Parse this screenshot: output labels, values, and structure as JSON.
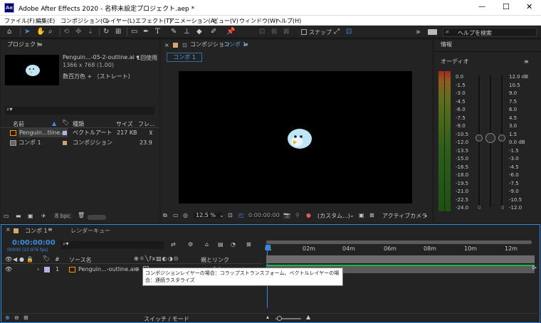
{
  "window": {
    "app_badge": "Ae",
    "title": "Adobe After Effects 2020 - 名称未設定プロジェクト.aep *",
    "minimize": "—",
    "maximize": "☐",
    "close": "✕"
  },
  "menu": [
    "ファイル(F)",
    "編集(E)",
    "コンポジション(C)",
    "レイヤー(L)",
    "エフェクト(T)",
    "アニメーション(A)",
    "ビュー(V)",
    "ウィンドウ(W)",
    "ヘルプ(H)"
  ],
  "toolbar": {
    "snap_label": "スナップ",
    "help_placeholder": "ヘルプを検索",
    "expand": "»"
  },
  "project": {
    "title": "プロジェクト",
    "selected_name": "Penguin...-05-2-outline.ai ▾",
    "used": "1回使用",
    "dims": "1366 x 768 (1.00)",
    "color_info": "数百万色 + （ストレート）",
    "bpc": "8 bpc",
    "columns": [
      "名前",
      "種類",
      "サイズ",
      "フレ..."
    ],
    "items": [
      {
        "name": "Penguin...tline.ai",
        "type": "ベクトルアート",
        "size": "217 KB",
        "fr": ""
      },
      {
        "name": "コンポ 1",
        "type": "コンポジション",
        "size": "",
        "fr": "23.9"
      }
    ]
  },
  "comp": {
    "panel_prefix": "コンポジション",
    "comp_name": "コンポ 1",
    "tab": "コンポ 1",
    "zoom": "12.5 %",
    "timecode": "0:00:00:00",
    "resolution": "(カスタム...)",
    "camera": "アクティブカメラ"
  },
  "info": {
    "title": "情報",
    "audio_title": "オーディオ",
    "left_scale": [
      "0.0",
      "-1.5",
      "-3.0",
      "-4.5",
      "-6.0",
      "-7.5",
      "-9.0",
      "-10.5",
      "-12.0",
      "-13.5",
      "-15.0",
      "-16.5",
      "-18.0",
      "-19.5",
      "-21.0",
      "-22.5",
      "-24.0"
    ],
    "right_scale": [
      "12.0 dB",
      "10.5",
      "9.0",
      "7.5",
      "6.0",
      "4.5",
      "3.0",
      "1.5",
      "0.0 dB",
      "-1.5",
      "-3.0",
      "-4.5",
      "-6.0",
      "-7.5",
      "-9.0",
      "-10.5",
      "-12.0"
    ],
    "knob_val_left": "0",
    "knob_val_right": "0"
  },
  "timeline": {
    "tab": "コンポ 1",
    "render_tab": "レンダーキュー",
    "timecode": "0:00:00:00",
    "frame_info": "00000 (23.976 fps)",
    "columns": {
      "num": "#",
      "source": "ソース名",
      "parent": "親とリンク"
    },
    "layer": {
      "num": "1",
      "name": "Penguin...-outline.ai",
      "parent": "なし"
    },
    "ruler": [
      "0s",
      "02m",
      "04m",
      "06m",
      "08m",
      "10m",
      "12m"
    ],
    "mode_label": "スイッチ / モード",
    "tooltip": "コンポジションレイヤーの場合：コラップストランスフォーム、ベクトルレイヤーの場合：連続ラスタライズ"
  },
  "colors": {
    "accent": "#2d8ceb",
    "timecode": "#3a8bdb",
    "workarea": "#5a5a5a",
    "green": "#1fb356"
  }
}
